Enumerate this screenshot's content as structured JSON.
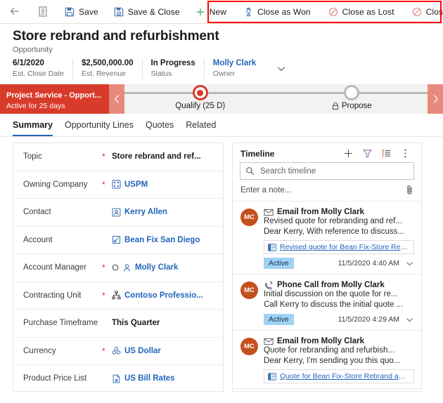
{
  "command_bar": {
    "back_icon": "back-arrow-icon",
    "form_icon": "form-selector-icon",
    "items": [
      {
        "label": "Save",
        "icon": "save-floppy-icon"
      },
      {
        "label": "Save & Close",
        "icon": "save-and-close-icon"
      },
      {
        "label": "New",
        "icon": "plus-icon"
      }
    ],
    "highlighted_items": [
      {
        "label": "Close as Won",
        "icon": "trophy-icon"
      },
      {
        "label": "Close as Lost",
        "icon": "no-entry-icon"
      },
      {
        "label": "Close all quotes",
        "icon": "no-entry-icon"
      }
    ],
    "highlight_color": "#ff0000"
  },
  "record_header": {
    "title": "Store rebrand and refurbishment",
    "entity": "Opportunity",
    "columns": [
      {
        "value": "6/1/2020",
        "label": "Est. Close Date",
        "is_link": false
      },
      {
        "value": "$2,500,000.00",
        "label": "Est. Revenue",
        "is_link": false
      },
      {
        "value": "In Progress",
        "label": "Status",
        "is_link": false
      },
      {
        "value": "Molly Clark",
        "label": "Owner",
        "is_link": true
      }
    ],
    "expand_icon": "chevron-down-icon"
  },
  "process_flow": {
    "name": "Project Service - Opport...",
    "active_text": "Active for 25 days",
    "prev_icon": "chevron-left-icon",
    "next_icon": "chevron-right-icon",
    "accent_color": "#d93b2b",
    "stages": [
      {
        "label": "Qualify  (25 D)",
        "state": "active",
        "locked": false
      },
      {
        "label": "Propose",
        "state": "idle",
        "locked": true,
        "lock_icon": "lock-icon"
      }
    ]
  },
  "tabs": [
    {
      "label": "Summary",
      "selected": true
    },
    {
      "label": "Opportunity Lines",
      "selected": false
    },
    {
      "label": "Quotes",
      "selected": false
    },
    {
      "label": "Related",
      "selected": false
    }
  ],
  "form": {
    "fields": [
      {
        "label": "Topic",
        "required": true,
        "value": "Store rebrand and ref...",
        "icon": null,
        "link": false
      },
      {
        "label": "Owning Company",
        "required": true,
        "value": "USPM",
        "icon": "company-icon",
        "link": true
      },
      {
        "label": "Contact",
        "required": false,
        "value": "Kerry Allen",
        "icon": "contact-icon",
        "link": true
      },
      {
        "label": "Account",
        "required": false,
        "value": "Bean Fix San Diego",
        "icon": "account-icon",
        "link": true
      },
      {
        "label": "Account Manager",
        "required": true,
        "value": "Molly Clark",
        "icon": "user-icon",
        "link": true,
        "prefix_icon": "presence-circle-icon"
      },
      {
        "label": "Contracting Unit",
        "required": true,
        "value": "Contoso Professio...",
        "icon": "org-unit-icon",
        "link": true
      },
      {
        "label": "Purchase Timeframe",
        "required": false,
        "value": "This Quarter",
        "icon": null,
        "link": false
      },
      {
        "label": "Currency",
        "required": true,
        "value": "US Dollar",
        "icon": "currency-icon",
        "link": true
      },
      {
        "label": "Product Price List",
        "required": false,
        "value": "US Bill Rates",
        "icon": "price-list-icon",
        "link": true
      }
    ]
  },
  "timeline": {
    "title": "Timeline",
    "actions": [
      {
        "icon": "plus-icon",
        "name": "create-record"
      },
      {
        "icon": "filter-icon",
        "name": "filter"
      },
      {
        "icon": "sort-icon",
        "name": "sort"
      },
      {
        "icon": "more-vertical-icon",
        "name": "more-commands"
      }
    ],
    "search_placeholder": "Search timeline",
    "search_value": "",
    "search_icon": "search-icon",
    "note_placeholder": "Enter a note...",
    "attach_icon": "paperclip-icon",
    "items": [
      {
        "avatar": "MC",
        "icon": "email-icon",
        "title": "Email from Molly Clark",
        "line1": "Revised quote for rebranding and ref...",
        "line2": "Dear Kerry, With reference to discuss...",
        "attachment": {
          "icon": "word-doc-icon",
          "name": "Revised quote for Bean Fix-Store Rebran..."
        },
        "badge": "Active",
        "time": "11/5/2020 4:40 AM",
        "chevron": "chevron-down-icon"
      },
      {
        "avatar": "MC",
        "icon": "phone-icon",
        "title": "Phone Call from Molly Clark",
        "line1": "Initial discussion on the quote for re...",
        "line2": "Call Kerry to discuss the initial quote ...",
        "attachment": null,
        "badge": "Active",
        "time": "11/5/2020 4:29 AM",
        "chevron": "chevron-down-icon"
      },
      {
        "avatar": "MC",
        "icon": "email-icon",
        "title": "Email from Molly Clark",
        "line1": "Quote for rebranding and refurbish...",
        "line2": "Dear Kerry, I'm sending you this quo...",
        "attachment": {
          "icon": "word-doc-icon",
          "name": "Quote for Bean Fix-Store Rebrand and R..."
        },
        "badge": null,
        "time": null,
        "chevron": null
      }
    ]
  }
}
